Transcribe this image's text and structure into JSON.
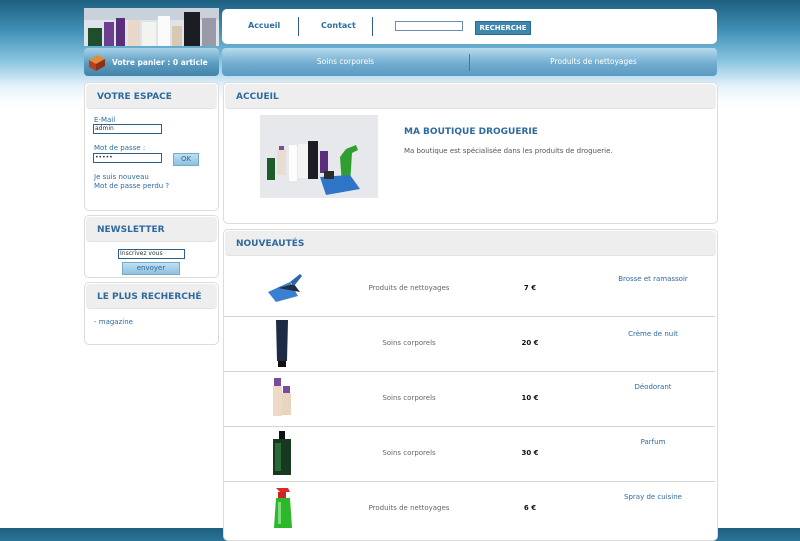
{
  "nav": {
    "home": "Accueil",
    "contact": "Contact",
    "search_value": "",
    "search_button": "RECHERCHE"
  },
  "cart": {
    "label": "Votre panier : 0 article"
  },
  "categories": [
    "Soins corporels",
    "Produits de nettoyages"
  ],
  "account": {
    "title": "VOTRE ESPACE",
    "email_label": "E-Mail",
    "email_value": "admin",
    "password_label": "Mot de passe :",
    "password_value": "•••••",
    "ok_button": "OK",
    "register_link": "Je suis nouveau",
    "forgot_link": "Mot de passe perdu ?"
  },
  "newsletter": {
    "title": "NEWSLETTER",
    "input_value": "Inscrivez vous",
    "button": "envoyer"
  },
  "popular": {
    "title": "LE PLUS RECHERCHÉ",
    "items": [
      "- magazine"
    ]
  },
  "welcome": {
    "section_title": "ACCUEIL",
    "heading": "MA BOUTIQUE DROGUERIE",
    "text": "Ma boutique est spécialisée dans les produits de droguerie."
  },
  "new_products": {
    "section_title": "NOUVEAUTÉS",
    "items": [
      {
        "icon": "dustpan-brush-icon",
        "category": "Produits de nettoyages",
        "price": "7 €",
        "name": "Brosse et ramassoir"
      },
      {
        "icon": "cream-tube-icon",
        "category": "Soins corporels",
        "price": "20 €",
        "name": "Crème de nuit"
      },
      {
        "icon": "deodorant-bottles-icon",
        "category": "Soins corporels",
        "price": "10 €",
        "name": "Déodorant"
      },
      {
        "icon": "perfume-bottle-icon",
        "category": "Soins corporels",
        "price": "30 €",
        "name": "Parfum"
      },
      {
        "icon": "spray-bottle-icon",
        "category": "Produits de nettoyages",
        "price": "6 €",
        "name": "Spray de cuisine"
      }
    ]
  },
  "colors": {
    "accent": "#2e6a9e",
    "header_bar": "#5b9bbf",
    "page_top": "#1d5f80"
  }
}
